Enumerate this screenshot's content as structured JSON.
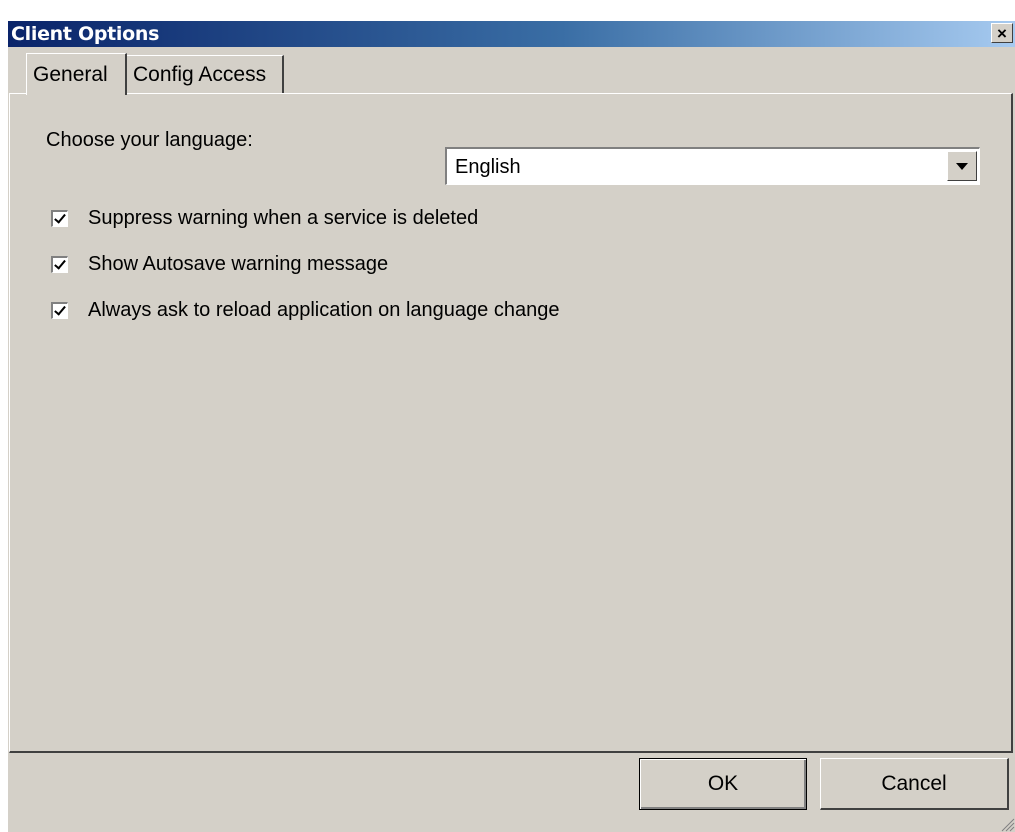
{
  "window": {
    "title": "Client Options",
    "close_label": "×"
  },
  "tabs": [
    {
      "label": "General",
      "selected": true
    },
    {
      "label": "Config Access",
      "selected": false
    }
  ],
  "general": {
    "language_label": "Choose your language:",
    "language_value": "English",
    "checkboxes": [
      {
        "label": "Suppress warning when a service is deleted",
        "checked": true
      },
      {
        "label": "Show Autosave warning message",
        "checked": true
      },
      {
        "label": "Always ask to reload application on language change",
        "checked": true
      }
    ]
  },
  "buttons": {
    "ok": "OK",
    "cancel": "Cancel"
  },
  "colors": {
    "title_gradient_start": "#0a246a",
    "title_gradient_end": "#a6caf0",
    "dialog_face": "#d4d0c8"
  }
}
